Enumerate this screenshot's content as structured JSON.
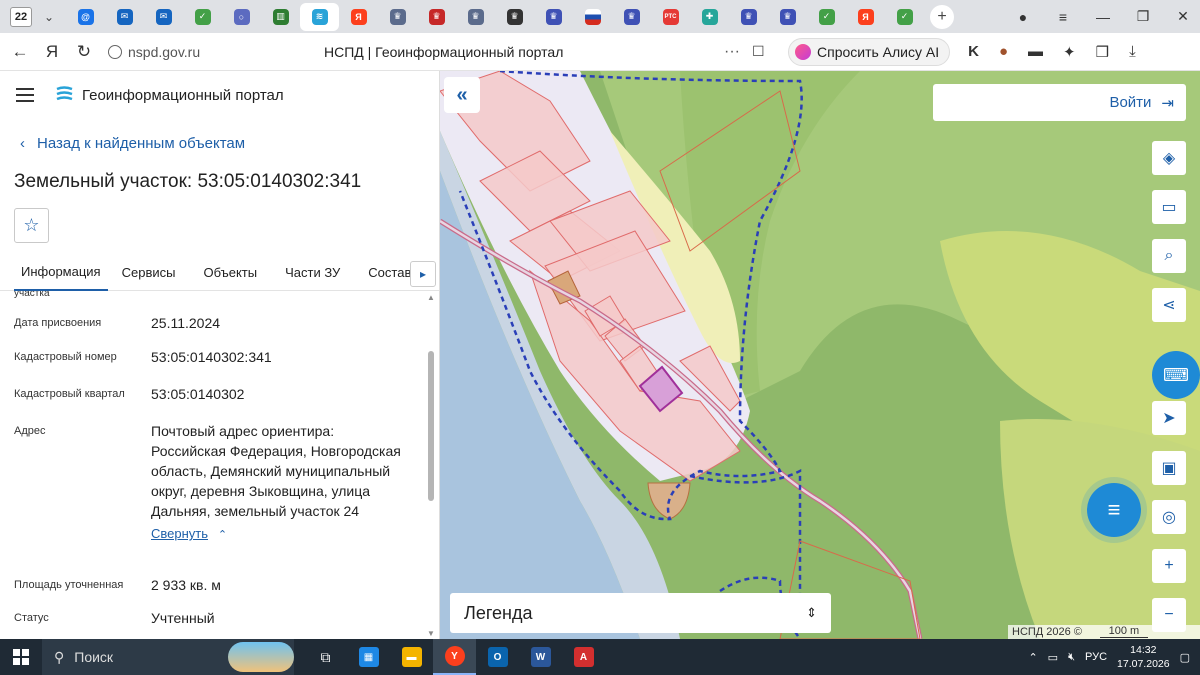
{
  "browser": {
    "tab_count": "22",
    "url": "nspd.gov.ru",
    "page_title": "НСПД | Геоинформационный портал",
    "alisa_label": "Спросить Алису AI"
  },
  "panel": {
    "portal_name": "Геоинформационный портал",
    "back_link": "Назад к найденным объектам",
    "object_title": "Земельный участок: 53:05:0140302:341",
    "tabs": [
      "Информация",
      "Сервисы",
      "Объекты",
      "Части ЗУ",
      "Состав"
    ],
    "partial_label": "участка",
    "properties": [
      {
        "label": "Дата присвоения",
        "value": "25.11.2024"
      },
      {
        "label": "Кадастровый номер",
        "value": "53:05:0140302:341"
      },
      {
        "label": "Кадастровый квартал",
        "value": "53:05:0140302"
      },
      {
        "label": "Адрес",
        "value": "Почтовый адрес ориентира: Российская Федерация, Новгородская область, Демянский муниципальный округ, деревня Зыковщина, улица Дальняя, земельный участок 24"
      },
      {
        "label": "Площадь уточненная",
        "value": "2 933 кв. м"
      },
      {
        "label": "Статус",
        "value": "Учтенный"
      }
    ],
    "collapse_label": "Свернуть"
  },
  "map": {
    "login_label": "Войти",
    "legend_label": "Легенда",
    "attribution": "НСПД 2026 ©",
    "scale": "100 m"
  },
  "taskbar": {
    "search_label": "Поиск",
    "language": "РУС",
    "time": "14:32",
    "date": "17.07.2026"
  }
}
